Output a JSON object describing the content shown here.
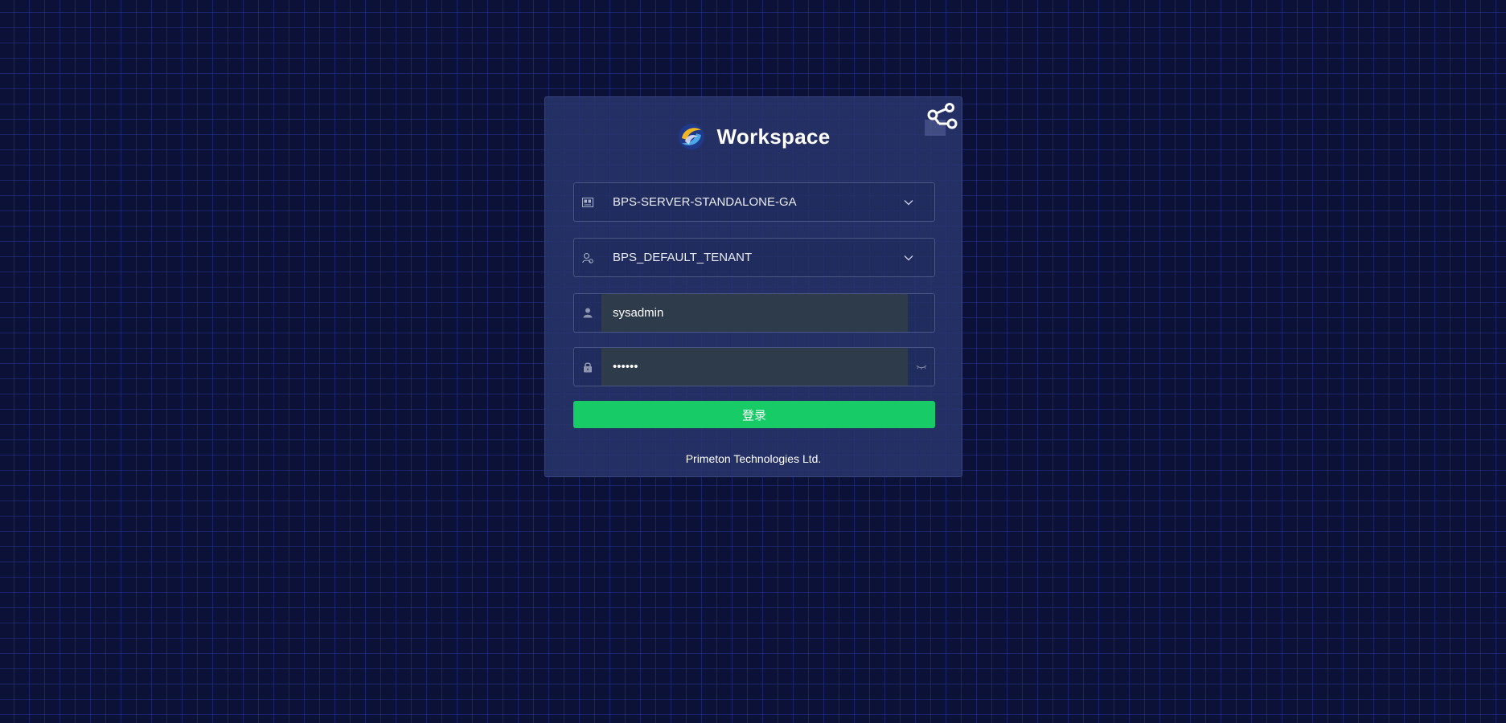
{
  "brand": {
    "title": "Workspace",
    "logo": "swirl-logo-icon"
  },
  "form": {
    "server": {
      "value": "BPS-SERVER-STANDALONE-GA",
      "icon": "server-icon"
    },
    "tenant": {
      "value": "BPS_DEFAULT_TENANT",
      "icon": "tenant-user-icon"
    },
    "username": {
      "value": "sysadmin",
      "icon": "user-icon"
    },
    "password": {
      "value": "••••••",
      "icon": "lock-icon",
      "toggle_icon": "eye-closed-icon"
    },
    "login_label": "登录"
  },
  "footer": {
    "company": "Primeton Technologies Ltd."
  },
  "colors": {
    "background": "#0c1137",
    "card": "#2a366c",
    "input_fill": "#2e3b4b",
    "login_button": "#17cc67"
  }
}
